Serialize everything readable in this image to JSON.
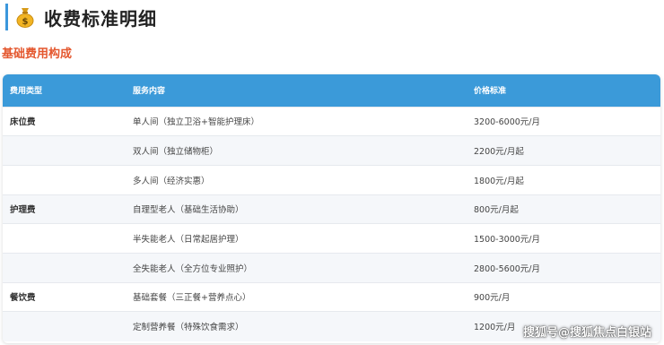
{
  "header": {
    "icon": "money-bag-icon",
    "title": "收费标准明细"
  },
  "section": {
    "title": "基础费用构成"
  },
  "table": {
    "columns": [
      "费用类型",
      "服务内容",
      "价格标准"
    ],
    "rows": [
      {
        "category": "床位费",
        "service": "单人间（独立卫浴+智能护理床）",
        "price": "3200-6000元/月"
      },
      {
        "category": "",
        "service": "双人间（独立储物柜）",
        "price": "2200元/月起"
      },
      {
        "category": "",
        "service": "多人间（经济实惠）",
        "price": "1800元/月起"
      },
      {
        "category": "护理费",
        "service": "自理型老人（基础生活协助）",
        "price": "800元/月起"
      },
      {
        "category": "",
        "service": "半失能老人（日常起居护理）",
        "price": "1500-3000元/月"
      },
      {
        "category": "",
        "service": "全失能老人（全方位专业照护）",
        "price": "2800-5600元/月"
      },
      {
        "category": "餐饮费",
        "service": "基础套餐（三正餐+营养点心）",
        "price": "900元/月"
      },
      {
        "category": "",
        "service": "定制营养餐（特殊饮食需求）",
        "price": "1200元/月"
      }
    ]
  },
  "watermark": "搜狐号@搜狐焦点白银站",
  "colors": {
    "accent": "#3b97dc",
    "header_bg": "#3b9ad9",
    "section_title": "#e4572e"
  }
}
